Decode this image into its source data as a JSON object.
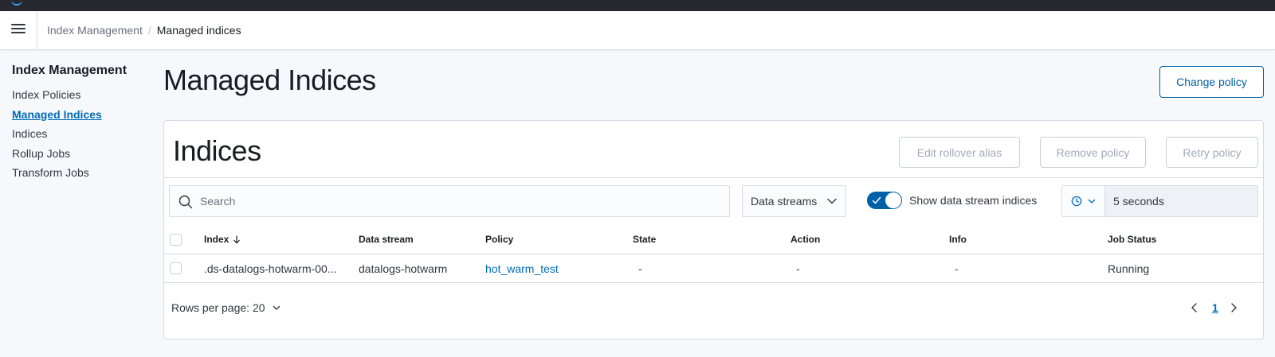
{
  "header": {
    "breadcrumbs": [
      "Index Management",
      "Managed indices"
    ]
  },
  "side_nav": {
    "title": "Index Management",
    "items": [
      {
        "label": "Index Policies",
        "active": false
      },
      {
        "label": "Managed Indices",
        "active": true
      },
      {
        "label": "Indices",
        "active": false
      },
      {
        "label": "Rollup Jobs",
        "active": false
      },
      {
        "label": "Transform Jobs",
        "active": false
      }
    ]
  },
  "page": {
    "title": "Managed Indices",
    "change_policy_label": "Change policy"
  },
  "panel": {
    "title": "Indices",
    "actions": {
      "edit_rollover_alias": "Edit rollover alias",
      "remove_policy": "Remove policy",
      "retry_policy": "Retry policy"
    },
    "search": {
      "placeholder": "Search",
      "value": ""
    },
    "data_streams_select": "Data streams",
    "show_data_stream_toggle": {
      "label": "Show data stream indices",
      "on": true
    },
    "refresh_interval": "5 seconds",
    "table": {
      "columns": [
        "Index",
        "Data stream",
        "Policy",
        "State",
        "Action",
        "Info",
        "Job Status"
      ],
      "sort_icon": "arrow-down-icon",
      "rows": [
        {
          "index": ".ds-datalogs-hotwarm-00...",
          "data_stream": "datalogs-hotwarm",
          "policy": "hot_warm_test",
          "state": "-",
          "action": "-",
          "info": "-",
          "job_status": "Running"
        }
      ]
    },
    "pagination": {
      "rows_per_page": "Rows per page: 20",
      "current_page": "1"
    }
  },
  "colors": {
    "accent": "#006bb8",
    "toggle_on": "#0061a6",
    "topbar": "#25282f",
    "page_bg": "#f7f8fc"
  }
}
